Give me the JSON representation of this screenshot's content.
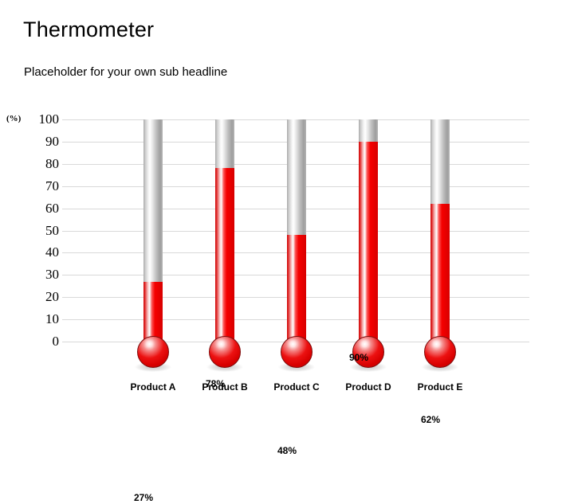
{
  "header": {
    "title": "Thermometer",
    "subtitle": "Placeholder for your own sub headline"
  },
  "chart_data": {
    "type": "bar",
    "title": "Thermometer",
    "subtitle": "Placeholder for your own sub headline",
    "categories": [
      "Product A",
      "Product B",
      "Product C",
      "Product D",
      "Product E"
    ],
    "values": [
      27,
      78,
      48,
      90,
      62
    ],
    "data_labels": [
      "27%",
      "78%",
      "48%",
      "90%",
      "62%"
    ],
    "xlabel": "",
    "ylabel": "(%)",
    "ylim": [
      0,
      100
    ],
    "yticks": [
      100,
      90,
      80,
      70,
      60,
      50,
      40,
      30,
      20,
      10,
      0
    ],
    "ytick_labels": [
      "100",
      "90",
      "80",
      "70",
      "60",
      "50",
      "40",
      "30",
      "20",
      "10",
      "0"
    ],
    "grid": true,
    "legend": false,
    "colors": {
      "fill": "#f50000",
      "tube": "#c9c9c9",
      "gridline": "#d9d9d9",
      "text": "#000000",
      "bulb_outline": "#7d0d0d"
    }
  }
}
